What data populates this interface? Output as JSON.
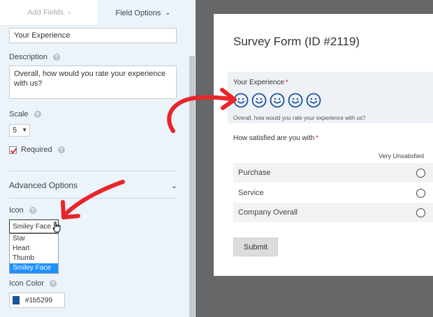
{
  "tabs": {
    "add_fields": "Add Fields",
    "add_fields_icon": "chevron-right-icon",
    "field_options": "Field Options",
    "field_options_icon": "chevron-down-icon"
  },
  "field": {
    "label_value": "Your Experience"
  },
  "description": {
    "label": "Description",
    "value": "Overall, how would you rate your experience with us?"
  },
  "scale": {
    "label": "Scale",
    "value": "5"
  },
  "required": {
    "label": "Required",
    "checked": true
  },
  "advanced": {
    "label": "Advanced Options"
  },
  "icon": {
    "label": "Icon",
    "selected": "Smiley Face",
    "options": [
      "Star",
      "Heart",
      "Thumb",
      "Smiley Face"
    ]
  },
  "icon_color": {
    "label": "Icon Color",
    "value": "#1b5299",
    "swatch": "#1b5299"
  },
  "form": {
    "title": "Survey Form (ID #2119)",
    "q1_label": "Your Experience",
    "q1_description": "Overall, how would you rate your experience with us?",
    "q1_icon_count": 5,
    "q2_label": "How satisfied are you with",
    "column_header": "Very Unsatisfied",
    "rows": [
      "Purchase",
      "Service",
      "Company Overall"
    ],
    "submit": "Submit"
  },
  "colors": {
    "arrow": "#e8262a",
    "panel_bg": "#ebf3fb",
    "preview_bg": "#666769",
    "accent": "#1b5299",
    "highlight": "#1e90ff"
  }
}
